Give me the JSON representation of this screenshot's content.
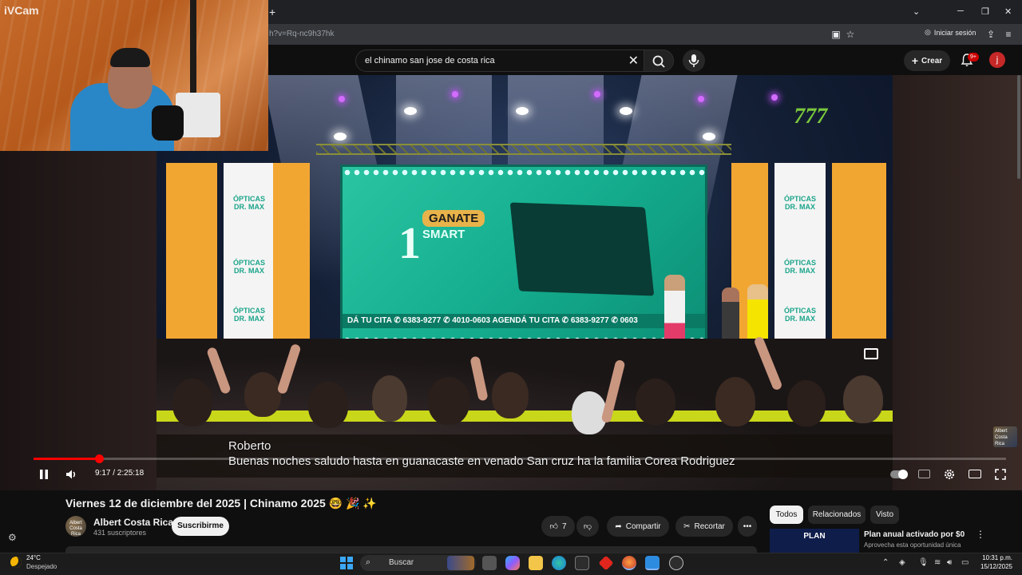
{
  "webcam": {
    "label": "iVCam"
  },
  "browser": {
    "url_fragment": "h?v=Rq-nc9h37hk",
    "new_tab": "+",
    "signin_label": "Iniciar sesión"
  },
  "youtube_header": {
    "search_query": "el chinamo san jose de costa rica",
    "create_label": "Crear",
    "notifications_badge": "9+",
    "avatar_letter": "j"
  },
  "video": {
    "screen": {
      "number": "1",
      "ganate": "GANATE",
      "smart": "SMART",
      "strip": "DÁ TU CITA  ✆ 6383-9277  ✆ 4010-0603  AGENDÁ TU CITA  ✆ 6383-9277  ✆ 0603"
    },
    "banner_brand_line1": "ÓPTICAS",
    "banner_brand_line2": "DR. MAX",
    "channel_logo": "777",
    "caption_speaker": "Roberto",
    "caption_text": "Buenas noches saludo hasta en guanacaste en venado San cruz ha la familia Corea Rodriguez",
    "current_time": "9:17",
    "duration": "2:25:18",
    "time_display": "9:17 / 2:25:18",
    "progress_fraction": 0.0675,
    "side_thumb_text": "Albert Costa Rica"
  },
  "details": {
    "title": "Viernes 12 de diciembre del 2025 | Chinamo 2025 🤓 🎉 ✨",
    "channel_name": "Albert Costa Rica",
    "channel_avatar_text": "Albert Costa Rica",
    "subscribers": "431 suscriptores",
    "subscribe_label": "Suscribirme",
    "likes": "7",
    "share_label": "Compartir",
    "clip_label": "Recortar"
  },
  "sidebar": {
    "chips": [
      "Todos",
      "Relacionados",
      "Visto"
    ],
    "promo": {
      "image_text": "PLAN",
      "title": "Plan anual activado por $0",
      "subtitle": "Aprovecha esta oportunidad única"
    }
  },
  "taskbar": {
    "temperature": "24°C",
    "weather": "Despejado",
    "search_label": "Buscar",
    "time": "10:31 p.m.",
    "date": "15/12/2025"
  },
  "colors": {
    "progress": "#ff0000",
    "accent_screen": "#15ae8f",
    "banner_orange": "#f2a632",
    "start_blue": "#3ba7f5"
  }
}
